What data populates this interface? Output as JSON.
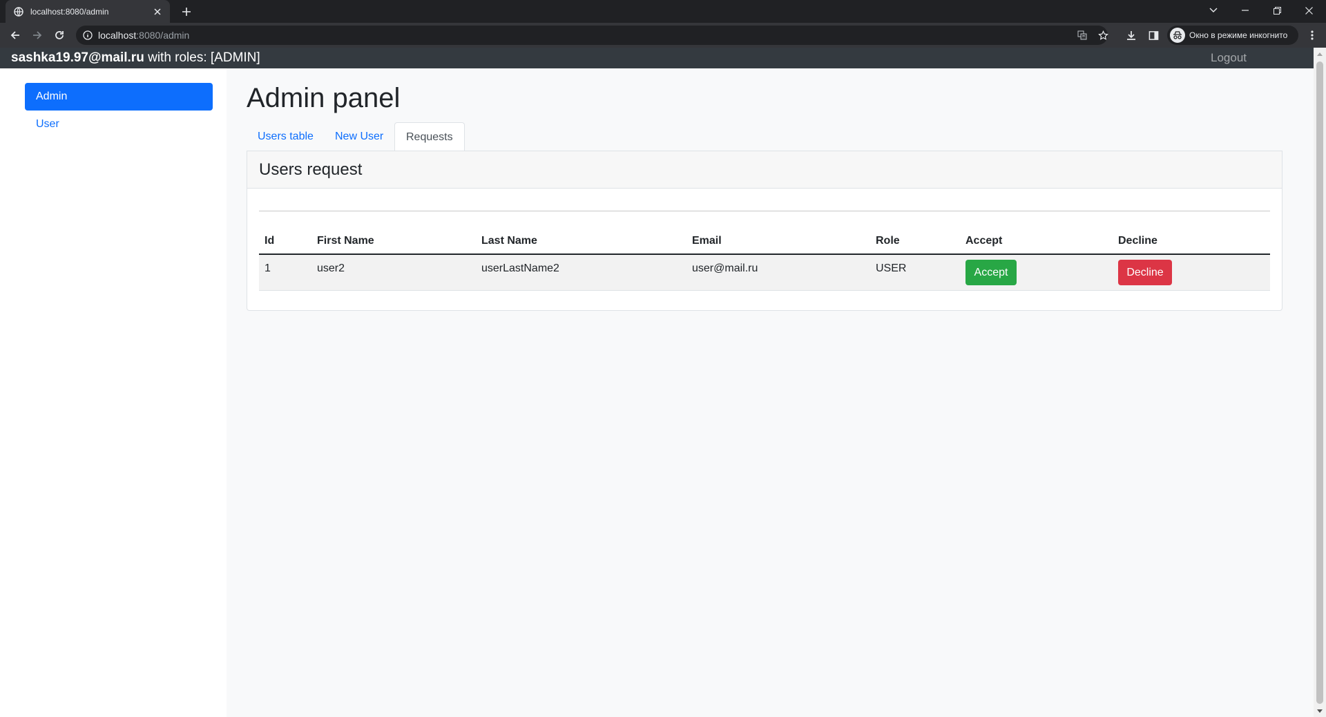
{
  "browser": {
    "tab_title": "localhost:8080/admin",
    "url_host": "localhost",
    "url_rest": ":8080/admin",
    "incognito_label": "Окно в режиме инкогнито"
  },
  "navbar": {
    "user_email": "sashka19.97@mail.ru",
    "roles_text": " with roles: [ADMIN]",
    "logout": "Logout"
  },
  "sidebar": {
    "items": [
      {
        "label": "Admin",
        "active": true
      },
      {
        "label": "User",
        "active": false
      }
    ]
  },
  "main": {
    "title": "Admin panel",
    "tabs": [
      {
        "label": "Users table",
        "active": false
      },
      {
        "label": "New User",
        "active": false
      },
      {
        "label": "Requests",
        "active": true
      }
    ],
    "card_title": "Users request",
    "table": {
      "headers": [
        "Id",
        "First Name",
        "Last Name",
        "Email",
        "Role",
        "Accept",
        "Decline"
      ],
      "rows": [
        {
          "id": "1",
          "first_name": "user2",
          "last_name": "userLastName2",
          "email": "user@mail.ru",
          "role": "USER",
          "accept": "Accept",
          "decline": "Decline"
        }
      ]
    }
  },
  "colors": {
    "primary": "#0d6efd",
    "navbar": "#343a40",
    "accept": "#28a745",
    "decline": "#dc3545"
  }
}
